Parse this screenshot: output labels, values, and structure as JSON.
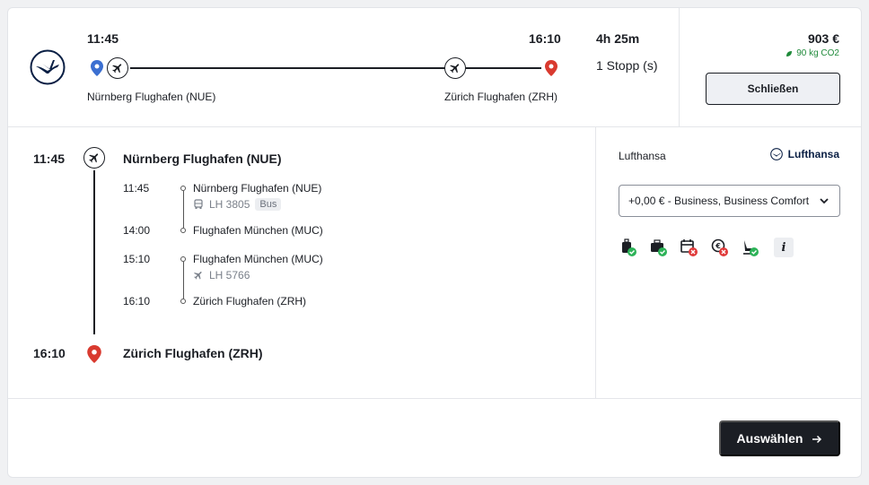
{
  "summary": {
    "depart_time": "11:45",
    "arrive_time": "16:10",
    "origin": "Nürnberg Flughafen (NUE)",
    "destination": "Zürich Flughafen (ZRH)",
    "duration": "4h 25m",
    "stops": "1 Stopp (s)",
    "price": "903 €",
    "co2": "90 kg CO2",
    "close_label": "Schließen"
  },
  "itinerary": {
    "start_time": "11:45",
    "start_place": "Nürnberg Flughafen (NUE)",
    "end_time": "16:10",
    "end_place": "Zürich Flughafen (ZRH)",
    "legs": [
      {
        "dep_time": "11:45",
        "dep_place": "Nürnberg Flughafen (NUE)",
        "flight": "LH 3805",
        "badge": "Bus",
        "arr_time": "14:00",
        "arr_place": "Flughafen München (MUC)",
        "mode_icon": "bus-icon"
      },
      {
        "dep_time": "15:10",
        "dep_place": "Flughafen München (MUC)",
        "flight": "LH 5766",
        "badge": "",
        "arr_time": "16:10",
        "arr_place": "Zürich Flughafen (ZRH)",
        "mode_icon": "plane-icon"
      }
    ]
  },
  "fare": {
    "airline": "Lufthansa",
    "airline_logo_text": "Lufthansa",
    "select_value": "+0,00 € - Business, Business Comfort",
    "features": [
      {
        "icon": "carry-on-bag-icon",
        "status": "included"
      },
      {
        "icon": "checked-bag-icon",
        "status": "included"
      },
      {
        "icon": "change-date-icon",
        "status": "excluded"
      },
      {
        "icon": "refund-icon",
        "status": "excluded"
      },
      {
        "icon": "seat-icon",
        "status": "included"
      },
      {
        "icon": "info-icon",
        "status": "info"
      }
    ]
  },
  "footer": {
    "select_label": "Auswählen"
  },
  "colors": {
    "dark": "#1b1e24",
    "origin_pin": "#3b6fd1",
    "destination_pin": "#d93a2f",
    "check": "#2db358",
    "cross": "#e03a3a",
    "co2_green": "#1f8a3a"
  }
}
